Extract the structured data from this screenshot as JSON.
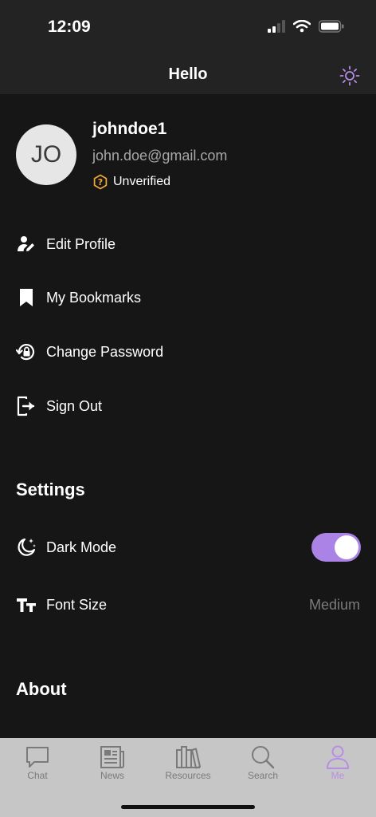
{
  "status_bar": {
    "time": "12:09"
  },
  "header": {
    "title": "Hello"
  },
  "profile": {
    "initials": "JO",
    "username": "johndoe1",
    "email": "john.doe@gmail.com",
    "verification_status": "Unverified"
  },
  "menu": [
    {
      "label": "Edit Profile",
      "icon": "edit-user-icon"
    },
    {
      "label": "My Bookmarks",
      "icon": "bookmark-icon"
    },
    {
      "label": "Change Password",
      "icon": "lock-reset-icon"
    },
    {
      "label": "Sign Out",
      "icon": "sign-out-icon"
    }
  ],
  "settings": {
    "title": "Settings",
    "dark_mode_label": "Dark Mode",
    "dark_mode_on": true,
    "font_size_label": "Font Size",
    "font_size_value": "Medium"
  },
  "about": {
    "title": "About"
  },
  "tabs": [
    {
      "label": "Chat",
      "icon": "chat-icon"
    },
    {
      "label": "News",
      "icon": "news-icon"
    },
    {
      "label": "Resources",
      "icon": "books-icon"
    },
    {
      "label": "Search",
      "icon": "search-icon"
    },
    {
      "label": "Me",
      "icon": "user-icon",
      "active": true
    }
  ],
  "colors": {
    "accent": "#ab82e6",
    "warning": "#f0a83a",
    "background": "#161616",
    "header": "#232323",
    "tabbar": "#c6c6c6"
  }
}
